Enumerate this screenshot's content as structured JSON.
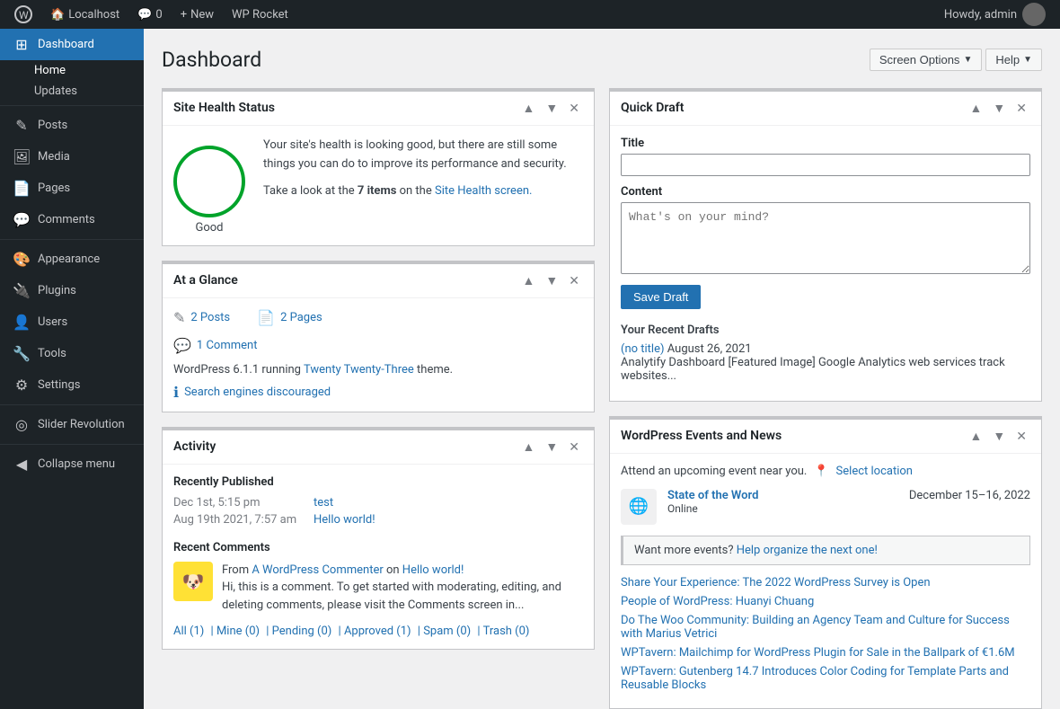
{
  "adminbar": {
    "wp_logo": "⚙",
    "site_name": "Localhost",
    "comments_count": "0",
    "new_label": "New",
    "plugin_label": "WP Rocket",
    "howdy": "Howdy, admin"
  },
  "sidebar": {
    "items": [
      {
        "id": "dashboard",
        "label": "Dashboard",
        "icon": "⊞",
        "active": true
      },
      {
        "id": "posts",
        "label": "Posts",
        "icon": "✎"
      },
      {
        "id": "media",
        "label": "Media",
        "icon": "🖼"
      },
      {
        "id": "pages",
        "label": "Pages",
        "icon": "📄"
      },
      {
        "id": "comments",
        "label": "Comments",
        "icon": "💬"
      },
      {
        "id": "appearance",
        "label": "Appearance",
        "icon": "🎨"
      },
      {
        "id": "plugins",
        "label": "Plugins",
        "icon": "🔌"
      },
      {
        "id": "users",
        "label": "Users",
        "icon": "👤"
      },
      {
        "id": "tools",
        "label": "Tools",
        "icon": "🔧"
      },
      {
        "id": "settings",
        "label": "Settings",
        "icon": "⚙"
      },
      {
        "id": "slider-revolution",
        "label": "Slider Revolution",
        "icon": "◎"
      }
    ],
    "sub_items": [
      {
        "label": "Home",
        "parent": "dashboard",
        "active": true
      },
      {
        "label": "Updates",
        "parent": "dashboard"
      }
    ],
    "collapse_label": "Collapse menu"
  },
  "header": {
    "title": "Dashboard",
    "screen_options": "Screen Options",
    "help": "Help"
  },
  "site_health": {
    "title": "Site Health Status",
    "health_label": "Good",
    "description": "Your site's health is looking good, but there are still some things you can do to improve its performance and security.",
    "items_text": "Take a look at the",
    "items_count": "7 items",
    "items_link_text": "Site Health screen.",
    "items_link": "#"
  },
  "at_a_glance": {
    "title": "At a Glance",
    "posts_count": "2 Posts",
    "pages_count": "2 Pages",
    "comments_count": "1 Comment",
    "wp_version": "WordPress 6.1.1 running",
    "theme_name": "Twenty Twenty-Three",
    "theme_text": "theme.",
    "search_engines": "Search engines discouraged"
  },
  "activity": {
    "title": "Activity",
    "recently_published_label": "Recently Published",
    "posts": [
      {
        "date": "Dec 1st, 5:15 pm",
        "title": "test",
        "link": "#"
      },
      {
        "date": "Aug 19th 2021, 7:57 am",
        "title": "Hello world!",
        "link": "#"
      }
    ],
    "recent_comments_label": "Recent Comments",
    "comments": [
      {
        "author": "A WordPress Commenter",
        "author_link": "#",
        "post": "Hello world!",
        "post_link": "#",
        "text": "Hi, this is a comment. To get started with moderating, editing, and deleting comments, please visit the Comments screen in..."
      }
    ],
    "filter": {
      "all": "All (1)",
      "mine": "Mine (0)",
      "pending": "Pending (0)",
      "approved": "Approved (1)",
      "spam": "Spam (0)",
      "trash": "Trash (0)"
    }
  },
  "quick_draft": {
    "title": "Quick Draft",
    "title_label": "Title",
    "title_placeholder": "",
    "content_label": "Content",
    "content_placeholder": "What's on your mind?",
    "save_btn": "Save Draft",
    "recent_drafts_label": "Your Recent Drafts",
    "drafts": [
      {
        "title": "(no title)",
        "date": "August 26, 2021",
        "excerpt": "Analytify Dashboard [Featured Image] Google Analytics web services track websites..."
      }
    ]
  },
  "events": {
    "title": "WordPress Events and News",
    "intro": "Attend an upcoming event near you.",
    "select_location": "Select location",
    "event_icon": "🌐",
    "event_name": "State of the Word",
    "event_location": "Online",
    "event_date": "December 15–16, 2022",
    "want_more": "Want more events?",
    "organize_link": "Help organize the next one!",
    "news": [
      {
        "text": "Share Your Experience: The 2022 WordPress Survey is Open",
        "link": "#"
      },
      {
        "text": "People of WordPress: Huanyi Chuang",
        "link": "#"
      },
      {
        "text": "Do The Woo Community: Building an Agency Team and Culture for Success with Marius Vetrici",
        "link": "#"
      },
      {
        "text": "WPTavern: Mailchimp for WordPress Plugin for Sale in the Ballpark of €1.6M",
        "link": "#"
      },
      {
        "text": "WPTavern: Gutenberg 14.7 Introduces Color Coding for Template Parts and Reusable Blocks",
        "link": "#"
      }
    ]
  }
}
